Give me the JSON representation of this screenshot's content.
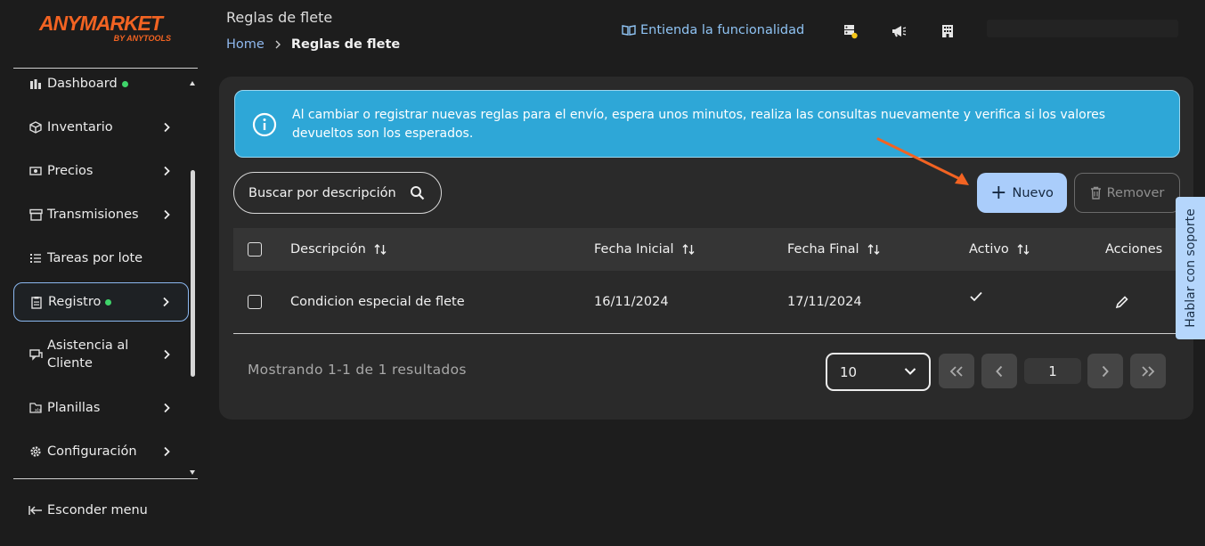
{
  "brand": {
    "name": "ANYMARKET",
    "by": "BY ANYTOOLS",
    "color": "#f26322"
  },
  "sidebar": {
    "items": [
      {
        "label": "Dashboard",
        "icon": "bar-chart-icon",
        "dot": true
      },
      {
        "label": "Inventario",
        "icon": "box-icon",
        "chevron": true
      },
      {
        "label": "Precios",
        "icon": "money-icon",
        "chevron": true
      },
      {
        "label": "Transmisiones",
        "icon": "store-icon",
        "chevron": true
      },
      {
        "label": "Tareas por lote",
        "icon": "list-icon"
      },
      {
        "label": "Registro",
        "icon": "clipboard-icon",
        "dot": true,
        "chevron": true,
        "active": true
      },
      {
        "label_line1": "Asistencia al",
        "label_line2": "Cliente",
        "icon": "chat-icon",
        "chevron": true
      },
      {
        "label": "Planillas",
        "icon": "spreadsheet-icon",
        "chevron": true
      },
      {
        "label": "Configuración",
        "icon": "gear-icon",
        "chevron": true
      }
    ],
    "hide_menu": "Esconder menu"
  },
  "header": {
    "title": "Reglas de flete",
    "breadcrumb": {
      "home": "Home",
      "current": "Reglas de flete"
    },
    "learn_link": "Entienda la funcionalidad"
  },
  "alert": {
    "text": "Al cambiar o registrar nuevas reglas para el envío, espera unos minutos, realiza las consultas nuevamente y verifica si los valores devueltos son los esperados.",
    "color": "#2ea7d7"
  },
  "toolbar": {
    "search_label": "Buscar por descripción",
    "new_label": "Nuevo",
    "remove_label": "Remover"
  },
  "table": {
    "headers": {
      "description": "Descripción",
      "start": "Fecha Inicial",
      "end": "Fecha Final",
      "active": "Activo",
      "actions": "Acciones"
    },
    "rows": [
      {
        "description": "Condicion especial de flete",
        "start": "16/11/2024",
        "end": "17/11/2024",
        "active": true
      }
    ]
  },
  "pagination": {
    "showing": "Mostrando 1-1 de 1 resultados",
    "per_page": "10",
    "page": "1"
  },
  "support_tab": "Hablar con soporte",
  "accent_color": "#aacdfb"
}
